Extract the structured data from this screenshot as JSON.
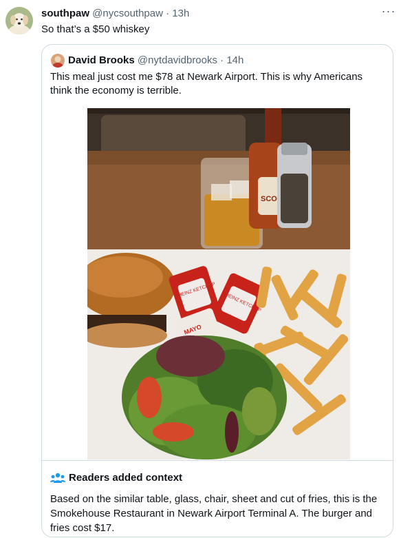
{
  "tweet": {
    "display_name": "southpaw",
    "handle": "@nycsouthpaw",
    "separator": "·",
    "time": "13h",
    "text": "So that’s a $50 whiskey",
    "more_label": "···",
    "avatar_icon": "dog-avatar"
  },
  "quoted_tweet": {
    "display_name": "David Brooks",
    "handle": "@nytdavidbrooks",
    "separator": "·",
    "time": "14h",
    "text": "This meal just cost me $78 at Newark Airport. This is why Americans think the economy is terrible.",
    "avatar_icon": "person-avatar",
    "photo": {
      "packet_text_1": "HEINZ KETCHUP",
      "packet_text_2": "HEINZ KETCHUP",
      "packet_text_3": "MAYO",
      "bottle_text": "SCO"
    }
  },
  "community_note": {
    "title": "Readers added context",
    "icon": "people-icon",
    "accent_color": "#1d9bf0",
    "body": "Based on the similar table, glass, chair, sheet and cut of fries, this is the Smokehouse Restaurant in Newark Airport Terminal A. The burger and fries cost $17."
  }
}
